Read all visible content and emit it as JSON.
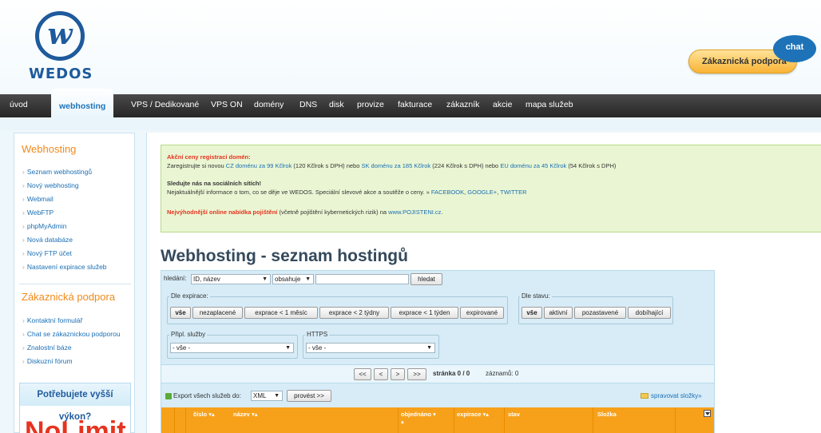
{
  "header": {
    "logo_text": "WEDOS",
    "support_label": "Zákaznická podpora",
    "chat_label": "chat"
  },
  "nav": {
    "items": [
      "úvod",
      "webhosting",
      "VPS / Dedikované",
      "VPS ON",
      "domény",
      "DNS",
      "disk",
      "provize",
      "fakturace",
      "zákazník",
      "akcie",
      "mapa služeb"
    ],
    "active": "webhosting"
  },
  "sidebar": {
    "webhosting_title": "Webhosting",
    "webhosting_items": [
      "Seznam webhostingů",
      "Nový webhosting",
      "Webmail",
      "WebFTP",
      "phpMyAdmin",
      "Nová databáze",
      "Nový FTP účet",
      "Nastavení expirace služeb"
    ],
    "support_title": "Zákaznická podpora",
    "support_items": [
      "Kontaktní formulář",
      "Chat se zákaznickou podporou",
      "Znalostní báze",
      "Diskuzní fórum"
    ],
    "promo_title": "Potřebujete vyšší výkon?",
    "promo_big": "NoLimit"
  },
  "notice": {
    "promo_title": "Akční ceny registrací domén:",
    "promo_line": {
      "a": "Zaregistrujte si novou ",
      "cz_link": "CZ doménu za 99 Kčlrok",
      "b": " (120 Kčlrok s DPH) nebo ",
      "sk_link": "SK doménu za 185 Kčlrok",
      "c": " (224 Kčlrok s DPH) nebo ",
      "eu_link": "EU doménu za 45 Kčlrok",
      "d": " (54 Kčlrok s DPH)"
    },
    "social_title": "Sledujte nás na sociálních sítích!",
    "social_line": {
      "a": "Nejaktuálnější informace o tom, co se děje ve WEDOS. Speciální slevové akce a soutěže o ceny. » ",
      "facebook": "FACEBOOK",
      "sep1": ", ",
      "google": "GOOGLE+",
      "sep2": ", ",
      "twitter": "TWITTER"
    },
    "insurance": {
      "red": "Nejvýhodnější online nabídka pojištění",
      "a": " (včetně pojištění kybernetických rizik) na ",
      "link": "www.POJISTENI.cz",
      "b": "."
    }
  },
  "page_title": "Webhosting - seznam hostingů",
  "search": {
    "label": "hledání:",
    "field_value": "ID, název",
    "mode_value": "obsahuje",
    "query_value": "",
    "button": "hledat"
  },
  "expiry_filter": {
    "legend": "Dle expirace:",
    "buttons": [
      "vše",
      "nezaplacené",
      "exprace < 1 měsíc",
      "exprace < 2 týdny",
      "exprace < 1 týden",
      "expirované"
    ],
    "active": "vše"
  },
  "state_filter": {
    "legend": "Dle stavu:",
    "buttons": [
      "vše",
      "aktivní",
      "pozastavené",
      "dobíhající"
    ],
    "active": "vše"
  },
  "services_filter": {
    "legend": "Připl. služby",
    "value": "- vše -"
  },
  "https_filter": {
    "legend": "HTTPS",
    "value": "- vše -"
  },
  "pager": {
    "first": "<<",
    "prev": "<",
    "next": ">",
    "last": ">>",
    "page_label": "stránka 0 / 0",
    "count_label": "záznamů: 0"
  },
  "export": {
    "label": "Export všech služeb do:",
    "format": "XML",
    "run_button": "provést >>",
    "folders_link": "spravovat složky»"
  },
  "table": {
    "columns": [
      "číslo",
      "název",
      "objednáno",
      "expirace",
      "stav",
      "Složka"
    ]
  },
  "colors": {
    "nav": "#2f2f2f",
    "accent_orange": "#f7a11a",
    "brand_blue": "#1e5a9c",
    "notice_bg": "#eaf6d3"
  }
}
